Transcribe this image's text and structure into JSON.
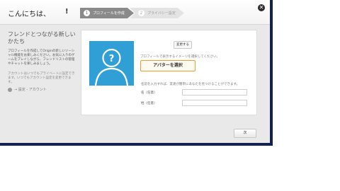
{
  "header": {
    "greeting": "こんにちは、",
    "alert_mark": "!",
    "steps": [
      {
        "number": "1",
        "label": "プロフィールを作成"
      },
      {
        "number": "2",
        "label": "プライバシー設定"
      }
    ],
    "close_glyph": "✕"
  },
  "left": {
    "title": "フレンドとつながる新しいかたち",
    "description": "プロフィールを作成してOriginの新しいソーシャル機能をお楽しみください。お気に入りのゲームをプレイしながら、フレンドリストの管理やチャットを楽しみましょう。",
    "note": "アカウントはいつでもプライベートに設定できます。いつでもアカウント設定を変更できます。",
    "settings_link": "→ 設定 - アカウント"
  },
  "card": {
    "change_button": "変更する",
    "image_hint": "プロフィールで表示するイメージを選択してください。",
    "avatar_button": "アバターを選択",
    "name_hint": "名前を入力すれば、友達が簡単にあなたを見つけることができます。",
    "first_name_label": "名（任意）",
    "last_name_label": "姓（任意）",
    "first_name_value": "",
    "last_name_value": ""
  },
  "footer": {
    "next_button": "次"
  },
  "colors": {
    "avatar_bg": "#2f9fd6",
    "accent_orange": "#f0a032",
    "active_step": "#8a8a8a",
    "desktop_strip": "#12214f"
  },
  "icons": {
    "close": "close-icon",
    "settings": "gear-icon",
    "avatar": "person-placeholder-icon"
  }
}
